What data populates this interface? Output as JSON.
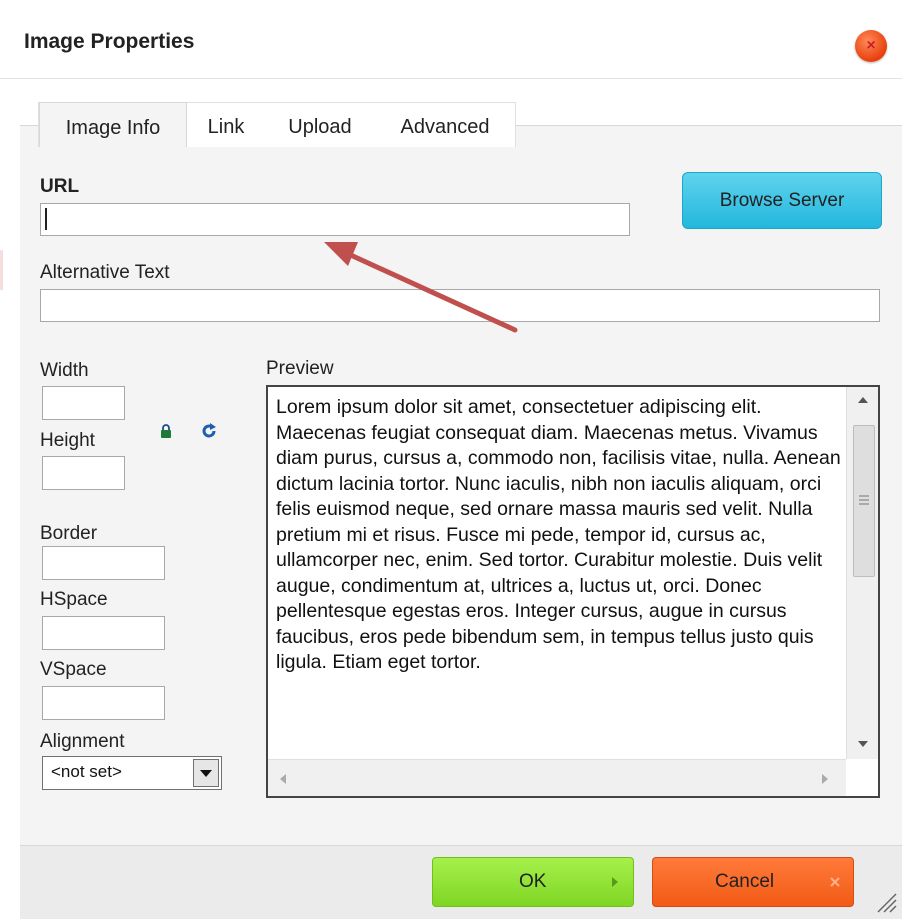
{
  "dialog": {
    "title": "Image Properties",
    "close_icon": "close-icon"
  },
  "tabs": [
    {
      "label": "Image Info",
      "active": true
    },
    {
      "label": "Link",
      "active": false
    },
    {
      "label": "Upload",
      "active": false
    },
    {
      "label": "Advanced",
      "active": false
    }
  ],
  "image_info": {
    "url_label": "URL",
    "url_value": "",
    "browse_label": "Browse Server",
    "alt_label": "Alternative Text",
    "alt_value": "",
    "width_label": "Width",
    "width_value": "",
    "height_label": "Height",
    "height_value": "",
    "lock_icon": "lock-icon",
    "reset_icon": "reset-size-icon",
    "border_label": "Border",
    "border_value": "",
    "hspace_label": "HSpace",
    "hspace_value": "",
    "vspace_label": "VSpace",
    "vspace_value": "",
    "alignment_label": "Alignment",
    "alignment_value": "<not set>",
    "preview_label": "Preview",
    "preview_text": "Lorem ipsum dolor sit amet, consectetuer adipiscing elit. Maecenas feugiat consequat diam. Maecenas metus. Vivamus diam purus, cursus a, commodo non, facilisis vitae, nulla. Aenean dictum lacinia tortor. Nunc iaculis, nibh non iaculis aliquam, orci felis euismod neque, sed ornare massa mauris sed velit. Nulla pretium mi et risus. Fusce mi pede, tempor id, cursus ac, ullamcorper nec, enim. Sed tortor. Curabitur molestie. Duis velit augue, condimentum at, ultrices a, luctus ut, orci. Donec pellentesque egestas eros. Integer cursus, augue in cursus faucibus, eros pede bibendum sem, in tempus tellus justo quis ligula. Etiam eget tortor."
  },
  "footer": {
    "ok_label": "OK",
    "cancel_label": "Cancel"
  },
  "colors": {
    "browse_button": "#23b7dd",
    "ok_button": "#7fd624",
    "cancel_button": "#f25b16",
    "annotation_arrow": "#c0504d"
  }
}
